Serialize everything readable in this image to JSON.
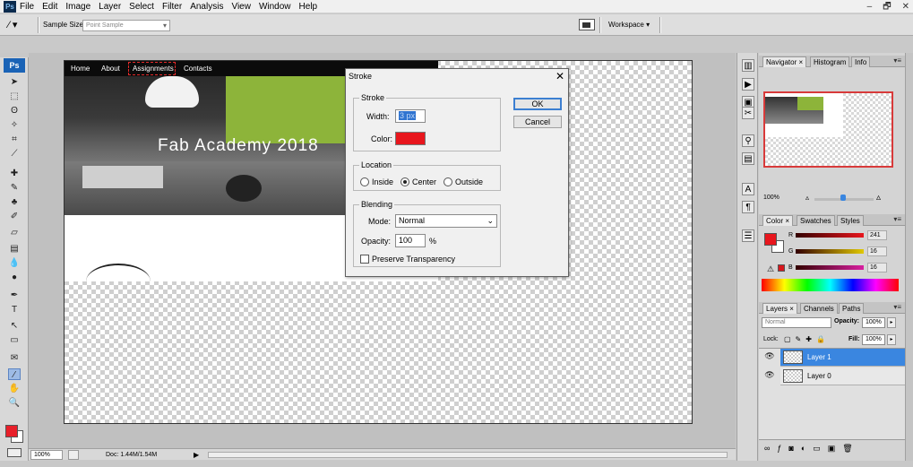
{
  "app": {
    "logo": "Ps"
  },
  "menubar": {
    "items": [
      "File",
      "Edit",
      "Image",
      "Layer",
      "Select",
      "Filter",
      "Analysis",
      "View",
      "Window",
      "Help"
    ],
    "window_controls": [
      "–",
      "🗗",
      "✕"
    ]
  },
  "options_bar": {
    "sample_size_label": "Sample Size:",
    "sample_size_value": "Point Sample",
    "workspace_label": "Workspace ▾"
  },
  "toolbox": {
    "logo": "Ps",
    "tools": [
      {
        "name": "move-tool-icon",
        "glyph": "➤"
      },
      {
        "name": "marquee-tool-icon",
        "glyph": "⬚"
      },
      {
        "name": "lasso-tool-icon",
        "glyph": "ʘ"
      },
      {
        "name": "magic-wand-tool-icon",
        "glyph": "✧"
      },
      {
        "name": "crop-tool-icon",
        "glyph": "⌗"
      },
      {
        "name": "slice-tool-icon",
        "glyph": "⟋"
      },
      {
        "name": "healing-brush-tool-icon",
        "glyph": "✚"
      },
      {
        "name": "brush-tool-icon",
        "glyph": "✎"
      },
      {
        "name": "clone-stamp-tool-icon",
        "glyph": "♣"
      },
      {
        "name": "history-brush-tool-icon",
        "glyph": "✐"
      },
      {
        "name": "eraser-tool-icon",
        "glyph": "▱"
      },
      {
        "name": "gradient-tool-icon",
        "glyph": "▤"
      },
      {
        "name": "blur-tool-icon",
        "glyph": "💧"
      },
      {
        "name": "dodge-tool-icon",
        "glyph": "●"
      },
      {
        "name": "pen-tool-icon",
        "glyph": "✒"
      },
      {
        "name": "type-tool-icon",
        "glyph": "T"
      },
      {
        "name": "path-selection-tool-icon",
        "glyph": "↖"
      },
      {
        "name": "shape-tool-icon",
        "glyph": "▭"
      },
      {
        "name": "notes-tool-icon",
        "glyph": "✉"
      },
      {
        "name": "eyedropper-tool-icon",
        "glyph": "⁄"
      },
      {
        "name": "hand-tool-icon",
        "glyph": "✋"
      },
      {
        "name": "zoom-tool-icon",
        "glyph": "🔍"
      }
    ]
  },
  "document": {
    "nav_items": [
      "Home",
      "About",
      "Assignments",
      "Contacts"
    ],
    "header_title": "Fab Academy 2018"
  },
  "stroke_dialog": {
    "title": "Stroke",
    "close_glyph": "✕",
    "stroke_group": "Stroke",
    "width_label": "Width:",
    "width_value": "3 px",
    "color_label": "Color:",
    "stroke_color": "#e8161d",
    "location_group": "Location",
    "location_options": [
      "Inside",
      "Center",
      "Outside"
    ],
    "location_selected": "Center",
    "blending_group": "Blending",
    "mode_label": "Mode:",
    "mode_value": "Normal",
    "opacity_label": "Opacity:",
    "opacity_value": "100",
    "opacity_unit": "%",
    "preserve_label": "Preserve Transparency",
    "preserve_checked": false,
    "ok_label": "OK",
    "cancel_label": "Cancel"
  },
  "navigator_panel": {
    "tabs": [
      "Navigator ×",
      "Histogram",
      "Info"
    ],
    "zoom_value": "100%"
  },
  "color_panel": {
    "tabs": [
      "Color ×",
      "Swatches",
      "Styles"
    ],
    "foreground_color": "#e8161d",
    "channels": [
      {
        "label": "R",
        "value": "241",
        "color": "#e8161d"
      },
      {
        "label": "G",
        "value": "16",
        "color": "#e0c800"
      },
      {
        "label": "B",
        "value": "16",
        "color": "#d81fa0"
      }
    ]
  },
  "layers_panel": {
    "tabs": [
      "Layers ×",
      "Channels",
      "Paths"
    ],
    "blend_mode": "Normal",
    "opacity_label": "Opacity:",
    "opacity_value": "100%",
    "lock_label": "Lock:",
    "fill_label": "Fill:",
    "fill_value": "100%",
    "layers": [
      {
        "name": "Layer 1",
        "selected": true
      },
      {
        "name": "Layer 0",
        "selected": false
      }
    ]
  },
  "status_bar": {
    "zoom": "100%",
    "doc_info": "Doc: 1.44M/1.54M"
  }
}
